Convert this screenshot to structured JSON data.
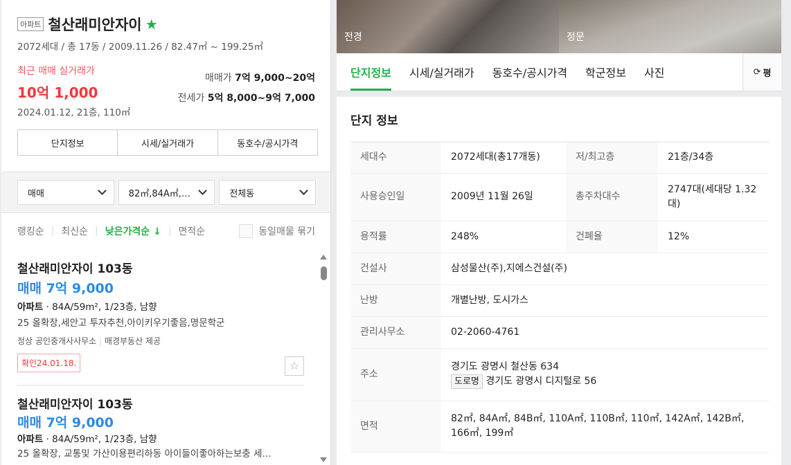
{
  "complex": {
    "type": "아파트",
    "name": "철산래미안자이",
    "summary": "2072세대 / 총 17동 / 2009.11.26 / 82.47㎡ ~ 199.25㎡",
    "recent_label": "최근 매매 실거래가",
    "recent_price": "10억 1,000",
    "recent_detail": "2024.01.12, 21층, 110㎡",
    "sale_label": "매매가",
    "sale_range": "7억 9,000~20억",
    "jeonse_label": "전세가",
    "jeonse_range": "5억 8,000~9억 7,000",
    "buttons": [
      "단지정보",
      "시세/실거래가",
      "동호수/공시가격"
    ]
  },
  "filters": [
    "매매",
    "82㎡,84A㎡,…",
    "전체동"
  ],
  "sort": {
    "options": [
      "랭킹순",
      "최신순",
      "낮은가격순 ↓",
      "면적순"
    ],
    "group_label": "동일매물 묶기"
  },
  "listings": [
    {
      "name": "철산래미안자이 103동",
      "price": "매매 7억 9,000",
      "spec_type": "아파트",
      "spec": "84A/59m², 1/23층, 남향",
      "desc": "25 올확장,세안고 투자추천,아이키우기좋음,명문학군",
      "agent": "정상 공인중개사사무소",
      "provider": "매경부동산 제공",
      "confirmed": "확인24.01.18."
    },
    {
      "name": "철산래미안자이 103동",
      "price": "매매 7억 9,000",
      "spec_type": "아파트",
      "spec": "84A/59m², 1/23층, 남향",
      "desc": "25 올확장, 교통및 가산이용편리하동 아이들이좋아하는보충 세…"
    }
  ],
  "photos": [
    "전경",
    "정문"
  ],
  "tabs": [
    "단지정보",
    "시세/실거래가",
    "동호수/공시가격",
    "학군정보",
    "사진"
  ],
  "unit_toggle": "평",
  "info": {
    "title": "단지 정보",
    "rows": [
      [
        "세대수",
        "2072세대(총17개동)",
        "저/최고층",
        "21층/34층"
      ],
      [
        "사용승인일",
        "2009년 11월 26일",
        "총주차대수",
        "2747대(세대당 1.32대)"
      ],
      [
        "용적률",
        "248%",
        "건폐율",
        "12%"
      ]
    ],
    "builder_label": "건설사",
    "builder": "삼성물산(주),지에스건설(주)",
    "heating_label": "난방",
    "heating": "개별난방, 도시가스",
    "office_label": "관리사무소",
    "office": "02-2060-4761",
    "address_label": "주소",
    "address": "경기도 광명시 철산동 634",
    "road_tag": "도로명",
    "road_address": "경기도 광명시 디지털로 56",
    "area_label": "면적",
    "areas": "82㎡, 84A㎡, 84B㎡, 110A㎡, 110B㎡, 110㎡, 142A㎡, 142B㎡, 166㎡, 199㎡"
  },
  "colors": {
    "accent": "#1fb14a",
    "price_red": "#f0383b",
    "price_blue": "#2c8ae8"
  }
}
